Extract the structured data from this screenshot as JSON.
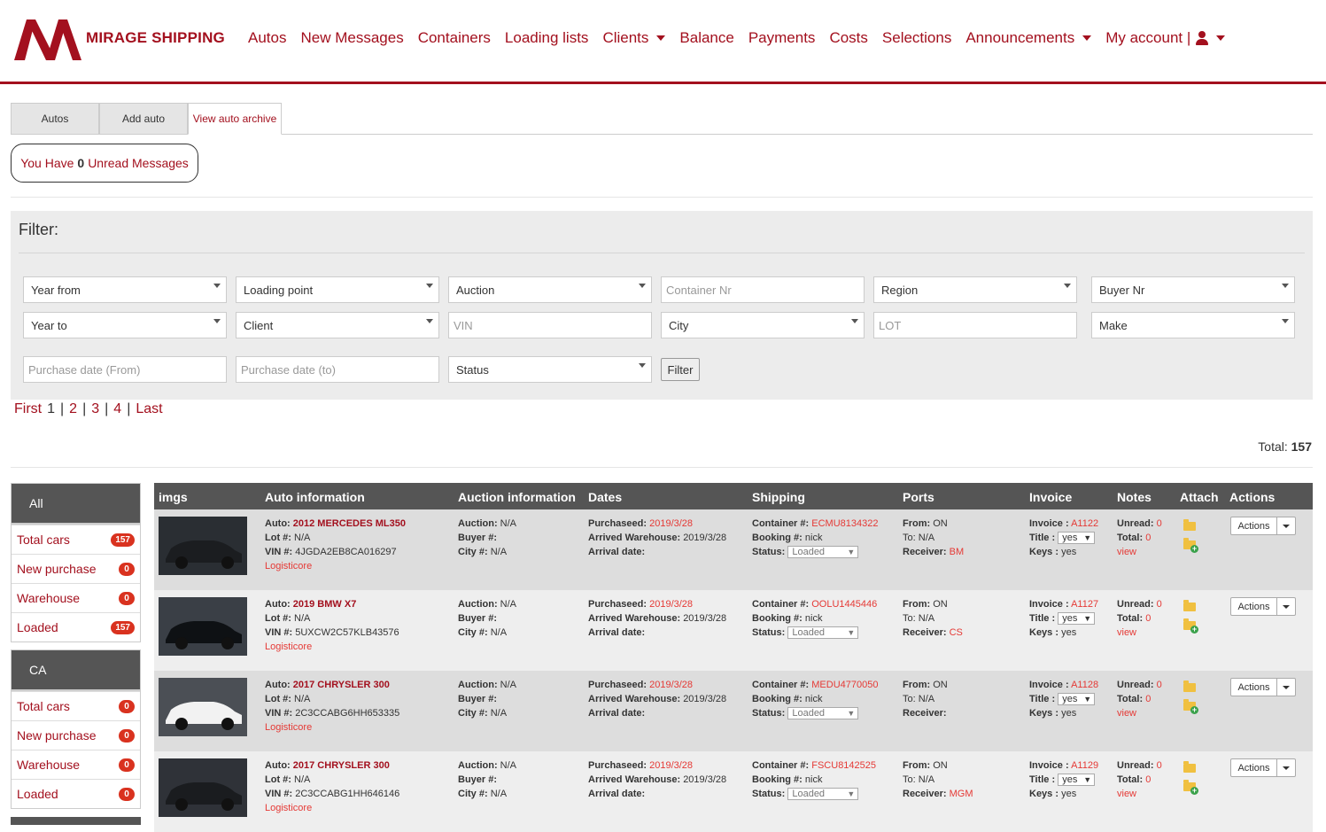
{
  "brand": {
    "name": "MIRAGE SHIPPING"
  },
  "nav": [
    {
      "label": "Autos"
    },
    {
      "label": "New Messages"
    },
    {
      "label": "Containers"
    },
    {
      "label": "Loading lists"
    },
    {
      "label": "Clients"
    },
    {
      "label": "Balance"
    },
    {
      "label": "Payments"
    },
    {
      "label": "Costs"
    },
    {
      "label": "Selections"
    },
    {
      "label": "Announcements"
    },
    {
      "label": "My account |"
    }
  ],
  "tabs": [
    {
      "label": "Autos"
    },
    {
      "label": "Add auto"
    },
    {
      "label": "View auto archive"
    }
  ],
  "unread": {
    "prefix": "You Have",
    "count": "0",
    "suffix": "Unread Messages"
  },
  "filter": {
    "title": "Filter:",
    "year_from": "Year from",
    "loading_point": "Loading point",
    "auction": "Auction",
    "container_nr": "Container Nr",
    "region": "Region",
    "buyer_nr": "Buyer Nr",
    "year_to": "Year to",
    "client": "Client",
    "vin": "VIN",
    "city": "City",
    "lot": "LOT",
    "make": "Make",
    "purchase_from": "Purchase date (From)",
    "purchase_to": "Purchase date (to)",
    "status": "Status",
    "button": "Filter"
  },
  "pager": {
    "first": "First",
    "pages": [
      "1",
      "2",
      "3",
      "4"
    ],
    "last": "Last",
    "sep": "|"
  },
  "total": {
    "label": "Total:",
    "value": "157"
  },
  "sidebar": [
    {
      "title": "All",
      "items": [
        {
          "label": "Total cars",
          "count": "157"
        },
        {
          "label": "New purchase",
          "count": "0"
        },
        {
          "label": "Warehouse",
          "count": "0"
        },
        {
          "label": "Loaded",
          "count": "157"
        }
      ]
    },
    {
      "title": "CA",
      "items": [
        {
          "label": "Total cars",
          "count": "0"
        },
        {
          "label": "New purchase",
          "count": "0"
        },
        {
          "label": "Warehouse",
          "count": "0"
        },
        {
          "label": "Loaded",
          "count": "0"
        }
      ]
    }
  ],
  "table": {
    "headers": [
      "imgs",
      "Auto information",
      "Auction information",
      "Dates",
      "Shipping",
      "Ports",
      "Invoice",
      "Notes",
      "Attach",
      "Actions"
    ],
    "labels": {
      "auto": "Auto:",
      "lot": "Lot #:",
      "vin": "VIN #:",
      "auction": "Auction:",
      "buyer": "Buyer #:",
      "city": "City #:",
      "purchased": "Purchaseed:",
      "arrived": "Arrived Warehouse:",
      "arrival": "Arrival date:",
      "container": "Container #:",
      "booking": "Booking #:",
      "status": "Status:",
      "from": "From:",
      "to": "To:",
      "receiver": "Receiver:",
      "invoice": "Invoice :",
      "title": "Title :",
      "keys": "Keys :",
      "unread": "Unread:",
      "total": "Total:",
      "view": "view",
      "actions": "Actions"
    },
    "rows": [
      {
        "auto": "2012 MERCEDES ML350",
        "lot": "N/A",
        "vin": "4JGDA2EB8CA016297",
        "company": "Logisticore",
        "auction": "N/A",
        "buyer": "",
        "city": "N/A",
        "purchased": "2019/3/28",
        "arrived": "2019/3/28",
        "arrival": "",
        "container": "ECMU8134322",
        "booking": "nick",
        "status": "Loaded",
        "from": "ON",
        "to": "N/A",
        "receiver": "BM",
        "invoice": "A1122",
        "title": "yes",
        "keys": "yes",
        "unread": "0",
        "total": "0"
      },
      {
        "auto": "2019 BMW X7",
        "lot": "N/A",
        "vin": "5UXCW2C57KLB43576",
        "company": "Logisticore",
        "auction": "N/A",
        "buyer": "",
        "city": "N/A",
        "purchased": "2019/3/28",
        "arrived": "2019/3/28",
        "arrival": "",
        "container": "OOLU1445446",
        "booking": "nick",
        "status": "Loaded",
        "from": "ON",
        "to": "N/A",
        "receiver": "CS",
        "invoice": "A1127",
        "title": "yes",
        "keys": "yes",
        "unread": "0",
        "total": "0"
      },
      {
        "auto": "2017 CHRYSLER 300",
        "lot": "N/A",
        "vin": "2C3CCABG6HH653335",
        "company": "Logisticore",
        "auction": "N/A",
        "buyer": "",
        "city": "N/A",
        "purchased": "2019/3/28",
        "arrived": "2019/3/28",
        "arrival": "",
        "container": "MEDU4770050",
        "booking": "nick",
        "status": "Loaded",
        "from": "ON",
        "to": "N/A",
        "receiver": "",
        "invoice": "A1128",
        "title": "yes",
        "keys": "yes",
        "unread": "0",
        "total": "0"
      },
      {
        "auto": "2017 CHRYSLER 300",
        "lot": "N/A",
        "vin": "2C3CCABG1HH646146",
        "company": "Logisticore",
        "auction": "N/A",
        "buyer": "",
        "city": "N/A",
        "purchased": "2019/3/28",
        "arrived": "2019/3/28",
        "arrival": "",
        "container": "FSCU8142525",
        "booking": "nick",
        "status": "Loaded",
        "from": "ON",
        "to": "N/A",
        "receiver": "MGM",
        "invoice": "A1129",
        "title": "yes",
        "keys": "yes",
        "unread": "0",
        "total": "0"
      }
    ]
  },
  "colors": {
    "brand": "#a3101e",
    "link_red": "#e53935",
    "badge": "#d9321f",
    "header_dark": "#555555"
  }
}
